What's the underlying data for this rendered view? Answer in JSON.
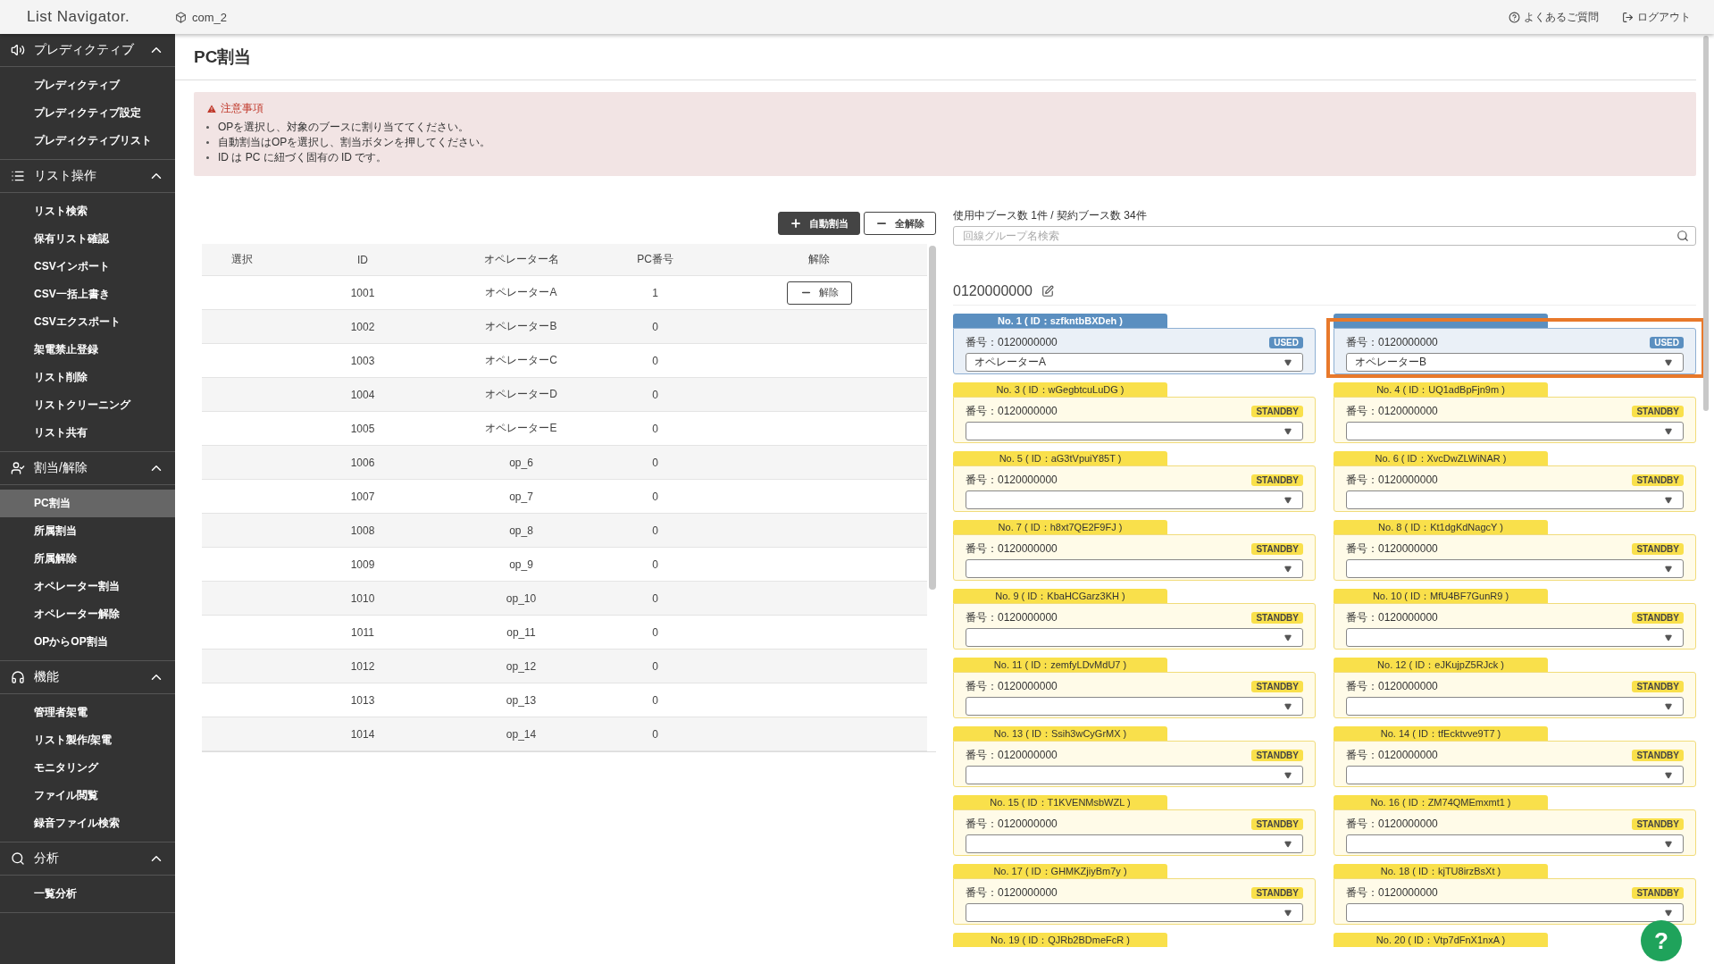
{
  "header": {
    "logo": "List Navigator.",
    "company": "com_2",
    "links": [
      {
        "kind": "faq",
        "label": "よくあるご質問"
      },
      {
        "kind": "logout",
        "label": "ログアウト"
      }
    ]
  },
  "sidebar": {
    "sections": [
      {
        "kind": "predictive",
        "title": "プレディクティブ",
        "expanded": true,
        "items": [
          {
            "label": "プレディクティブ",
            "selected": false
          },
          {
            "label": "プレディクティブ設定",
            "selected": false
          },
          {
            "label": "プレディクティブリスト",
            "selected": false
          }
        ]
      },
      {
        "kind": "list",
        "title": "リスト操作",
        "expanded": true,
        "items": [
          {
            "label": "リスト検索",
            "selected": false
          },
          {
            "label": "保有リスト確認",
            "selected": false
          },
          {
            "label": "CSVインポート",
            "selected": false
          },
          {
            "label": "CSV一括上書き",
            "selected": false
          },
          {
            "label": "CSVエクスポート",
            "selected": false
          },
          {
            "label": "架電禁止登録",
            "selected": false
          },
          {
            "label": "リスト削除",
            "selected": false
          },
          {
            "label": "リストクリーニング",
            "selected": false
          },
          {
            "label": "リスト共有",
            "selected": false
          }
        ]
      },
      {
        "kind": "assign",
        "title": "割当/解除",
        "expanded": true,
        "items": [
          {
            "label": "PC割当",
            "selected": true
          },
          {
            "label": "所属割当",
            "selected": false
          },
          {
            "label": "所属解除",
            "selected": false
          },
          {
            "label": "オペレーター割当",
            "selected": false
          },
          {
            "label": "オペレーター解除",
            "selected": false
          },
          {
            "label": "OPからOP割当",
            "selected": false
          }
        ]
      },
      {
        "kind": "headset",
        "title": "機能",
        "expanded": true,
        "items": [
          {
            "label": "管理者架電",
            "selected": false
          },
          {
            "label": "リスト製作/架電",
            "selected": false
          },
          {
            "label": "モニタリング",
            "selected": false
          },
          {
            "label": "ファイル閲覧",
            "selected": false
          },
          {
            "label": "録音ファイル検索",
            "selected": false
          }
        ]
      },
      {
        "kind": "search",
        "title": "分析",
        "expanded": true,
        "items": [
          {
            "label": "一覧分析",
            "selected": false
          }
        ]
      }
    ]
  },
  "page_title": "PC割当",
  "notice": {
    "title": "注意事項",
    "items": [
      "OPを選択し、対象のブースに割り当ててください。",
      "自動割当はOPを選択し、割当ボタンを押してください。",
      "ID は PC に紐づく固有の ID です。"
    ]
  },
  "actions": [
    {
      "kind": "add",
      "label": "自動割当"
    },
    {
      "kind": "remove",
      "label": "全解除"
    }
  ],
  "table": {
    "columns": [
      "選択",
      "ID",
      "オペレーター名",
      "PC番号",
      "解除"
    ],
    "rows": [
      {
        "id": "1001",
        "operator": "オペレーターA",
        "pc": "1",
        "release": "解除"
      },
      {
        "id": "1002",
        "operator": "オペレーターB",
        "pc": "0"
      },
      {
        "id": "1003",
        "operator": "オペレーターC",
        "pc": "0"
      },
      {
        "id": "1004",
        "operator": "オペレーターD",
        "pc": "0"
      },
      {
        "id": "1005",
        "operator": "オペレーターE",
        "pc": "0"
      },
      {
        "id": "1006",
        "operator": "op_6",
        "pc": "0"
      },
      {
        "id": "1007",
        "operator": "op_7",
        "pc": "0"
      },
      {
        "id": "1008",
        "operator": "op_8",
        "pc": "0"
      },
      {
        "id": "1009",
        "operator": "op_9",
        "pc": "0"
      },
      {
        "id": "1010",
        "operator": "op_10",
        "pc": "0"
      },
      {
        "id": "1011",
        "operator": "op_11",
        "pc": "0"
      },
      {
        "id": "1012",
        "operator": "op_12",
        "pc": "0"
      },
      {
        "id": "1013",
        "operator": "op_13",
        "pc": "0"
      },
      {
        "id": "1014",
        "operator": "op_14",
        "pc": "0"
      }
    ]
  },
  "booth_summary": "使用中ブース数 1件 / 契約ブース数 34件",
  "search": {
    "placeholder": "回線グループ名検索"
  },
  "group": {
    "number": "0120000000"
  },
  "booths": [
    {
      "label": "No. 1 ( ID：szfkntbBXDeh )",
      "number": "番号：0120000000",
      "status": "USED",
      "operator": "オペレーターA",
      "highlighted": false
    },
    {
      "number": "番号：0120000000",
      "status": "USED",
      "operator": "オペレーターB",
      "highlighted": true
    },
    {
      "label": "No. 3 ( ID：wGegbtcuLuDG )",
      "number": "番号：0120000000",
      "status": "STANDBY",
      "highlighted": false
    },
    {
      "label": "No. 4 ( ID：UQ1adBpFjn9m )",
      "number": "番号：0120000000",
      "status": "STANDBY",
      "highlighted": false
    },
    {
      "label": "No. 5 ( ID：aG3tVpuiY85T )",
      "number": "番号：0120000000",
      "status": "STANDBY",
      "highlighted": false
    },
    {
      "label": "No. 6 ( ID：XvcDwZLWiNAR )",
      "number": "番号：0120000000",
      "status": "STANDBY",
      "highlighted": false
    },
    {
      "label": "No. 7 ( ID：h8xt7QE2F9FJ )",
      "number": "番号：0120000000",
      "status": "STANDBY",
      "highlighted": false
    },
    {
      "label": "No. 8 ( ID：Kt1dgKdNagcY )",
      "number": "番号：0120000000",
      "status": "STANDBY",
      "highlighted": false
    },
    {
      "label": "No. 9 ( ID：KbaHCGarz3KH )",
      "number": "番号：0120000000",
      "status": "STANDBY",
      "highlighted": false
    },
    {
      "label": "No. 10 ( ID：MfU4BF7GunR9 )",
      "number": "番号：0120000000",
      "status": "STANDBY",
      "highlighted": false
    },
    {
      "label": "No. 11 ( ID：zemfyLDvMdU7 )",
      "number": "番号：0120000000",
      "status": "STANDBY",
      "highlighted": false
    },
    {
      "label": "No. 12 ( ID：eJKujpZ5RJck )",
      "number": "番号：0120000000",
      "status": "STANDBY",
      "highlighted": false
    },
    {
      "label": "No. 13 ( ID：Ssih3wCyGrMX )",
      "number": "番号：0120000000",
      "status": "STANDBY",
      "highlighted": false
    },
    {
      "label": "No. 14 ( ID：tfEcktvve9T7 )",
      "number": "番号：0120000000",
      "status": "STANDBY",
      "highlighted": false
    },
    {
      "label": "No. 15 ( ID：T1KVENMsbWZL )",
      "number": "番号：0120000000",
      "status": "STANDBY",
      "highlighted": false
    },
    {
      "label": "No. 16 ( ID：ZM74QMEmxmt1 )",
      "number": "番号：0120000000",
      "status": "STANDBY",
      "highlighted": false
    },
    {
      "label": "No. 17 ( ID：GHMKZjiyBm7y )",
      "number": "番号：0120000000",
      "status": "STANDBY",
      "highlighted": false
    },
    {
      "label": "No. 18 ( ID：kjTU8irzBsXt )",
      "number": "番号：0120000000",
      "status": "STANDBY",
      "highlighted": false
    },
    {
      "label": "No. 19 ( ID：QJRb2BDmeFcR )"
    },
    {
      "label": "No. 20 ( ID：Vtp7dFnX1nxA )"
    }
  ],
  "help_button": {
    "label": "?"
  }
}
